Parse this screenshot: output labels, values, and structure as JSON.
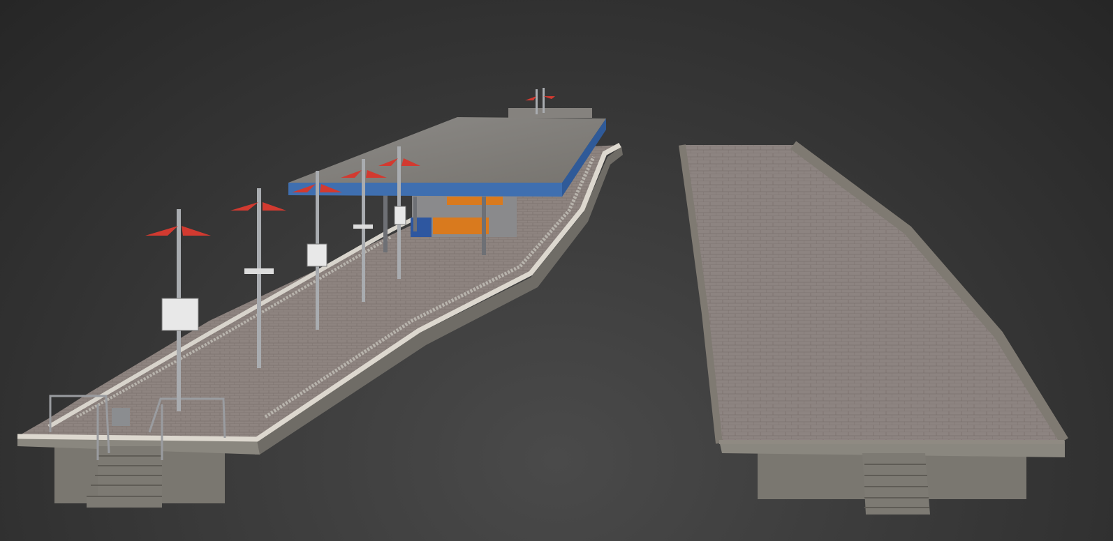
{
  "scene": {
    "subject": "3d-render-train-platforms",
    "colors": {
      "paving": "#8e8480",
      "paving_right": "#8d8481",
      "curb": "#d8d4cc",
      "concrete": "#7d7a73",
      "roof": "#858380",
      "roof_fascia": "#3f6fb0",
      "lamp_shade": "#d23a30",
      "pole": "#a9acb0",
      "escalator": "#d97a1e"
    },
    "signs": [
      {
        "icon": "station-name-sign"
      },
      {
        "icon": "station-name-sign"
      },
      {
        "icon": "station-name-sign"
      }
    ]
  }
}
